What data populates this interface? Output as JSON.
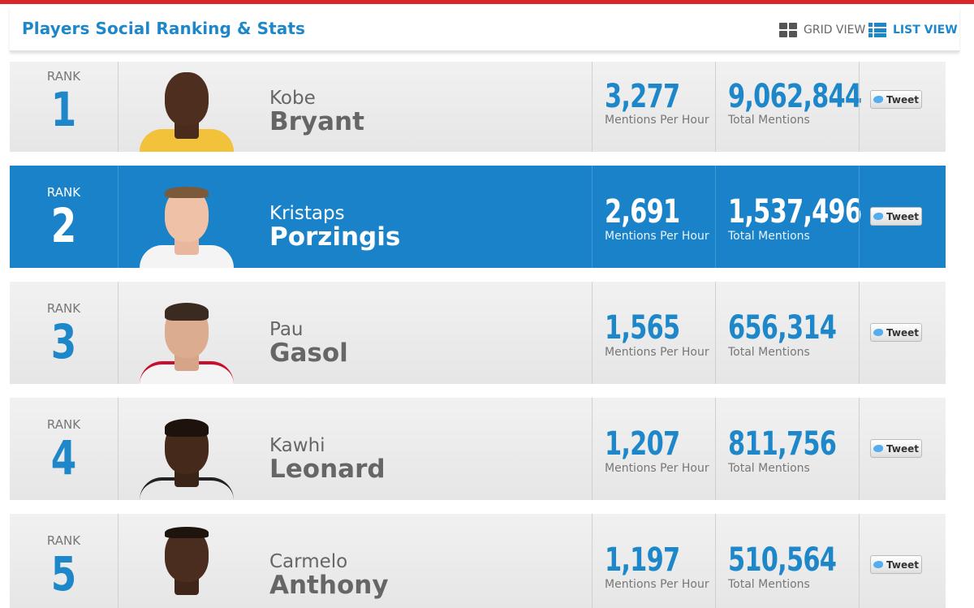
{
  "header": {
    "title": "Players Social Ranking & Stats",
    "grid_view_label": "GRID VIEW",
    "list_view_label": "LIST VIEW",
    "accent_color": "#1e87c9",
    "topbar_color": "#d9262c"
  },
  "players": [
    {
      "rank_label": "RANK",
      "rank": "1",
      "first": "Kobe",
      "last": "Bryant",
      "mph": "3,277",
      "mph_label": "Mentions Per Hour",
      "total": "9,062,844",
      "total_label": "Total Mentions",
      "tweet_label": "Tweet"
    },
    {
      "rank_label": "RANK",
      "rank": "2",
      "first": "Kristaps",
      "last": "Porzingis",
      "mph": "2,691",
      "mph_label": "Mentions Per Hour",
      "total": "1,537,496",
      "total_label": "Total Mentions",
      "tweet_label": "Tweet"
    },
    {
      "rank_label": "RANK",
      "rank": "3",
      "first": "Pau",
      "last": "Gasol",
      "mph": "1,565",
      "mph_label": "Mentions Per Hour",
      "total": "656,314",
      "total_label": "Total Mentions",
      "tweet_label": "Tweet"
    },
    {
      "rank_label": "RANK",
      "rank": "4",
      "first": "Kawhi",
      "last": "Leonard",
      "mph": "1,207",
      "mph_label": "Mentions Per Hour",
      "total": "811,756",
      "total_label": "Total Mentions",
      "tweet_label": "Tweet"
    },
    {
      "rank_label": "RANK",
      "rank": "5",
      "first": "Carmelo",
      "last": "Anthony",
      "mph": "1,197",
      "mph_label": "Mentions Per Hour",
      "total": "510,564",
      "total_label": "Total Mentions",
      "tweet_label": "Tweet"
    }
  ]
}
